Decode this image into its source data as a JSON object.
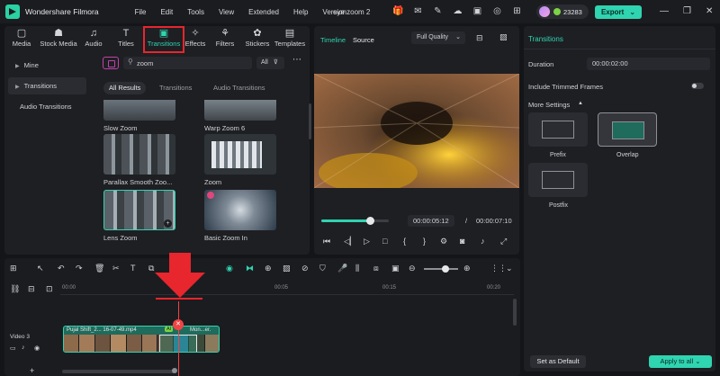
{
  "app": {
    "title": "Wondershare Filmora",
    "project_title": "eye zoom 2",
    "credits": "23283",
    "export_label": "Export"
  },
  "menu": [
    "File",
    "Edit",
    "Tools",
    "View",
    "Extended",
    "Help",
    "Version"
  ],
  "toolbar": [
    {
      "label": "Media",
      "icon": "media-icon"
    },
    {
      "label": "Stock Media",
      "icon": "stock-media-icon"
    },
    {
      "label": "Audio",
      "icon": "audio-icon"
    },
    {
      "label": "Titles",
      "icon": "titles-icon"
    },
    {
      "label": "Transitions",
      "icon": "transitions-icon",
      "active": true
    },
    {
      "label": "Effects",
      "icon": "effects-icon"
    },
    {
      "label": "Filters",
      "icon": "filters-icon"
    },
    {
      "label": "Stickers",
      "icon": "stickers-icon"
    },
    {
      "label": "Templates",
      "icon": "templates-icon"
    }
  ],
  "sidebar": {
    "items": [
      {
        "label": "Mine",
        "active": false
      },
      {
        "label": "Transitions",
        "active": true
      },
      {
        "label": "Audio Transitions",
        "active": false
      }
    ]
  },
  "search": {
    "value": "zoom",
    "filter_label": "All"
  },
  "subtabs": [
    {
      "label": "All Results",
      "active": true
    },
    {
      "label": "Transitions",
      "active": false
    },
    {
      "label": "Audio Transitions",
      "active": false
    }
  ],
  "library": {
    "items": [
      {
        "name": "Slow Zoom"
      },
      {
        "name": "Warp Zoom 6"
      },
      {
        "name": "Parallax Smooth Zoo..."
      },
      {
        "name": "Zoom"
      },
      {
        "name": "Lens Zoom"
      },
      {
        "name": "Basic Zoom In"
      }
    ]
  },
  "preview": {
    "tabs": [
      {
        "label": "Timeline",
        "active": true
      },
      {
        "label": "Source",
        "active": false
      }
    ],
    "quality": "Full Quality",
    "current_time": "00:00:05:12",
    "separator": "/",
    "total_time": "00:00:07:10",
    "progress_fraction": 0.72
  },
  "right_panel": {
    "title": "Transitions",
    "duration_label": "Duration",
    "duration_value": "00:00:02:00",
    "include_trimmed_label": "Include Trimmed Frames",
    "more_settings_label": "More Settings",
    "positions": [
      {
        "name": "Prefix",
        "selected": false
      },
      {
        "name": "Overlap",
        "selected": true
      },
      {
        "name": "Postfix",
        "selected": false
      }
    ],
    "set_default_label": "Set as Default",
    "apply_all_label": "Apply to all"
  },
  "timeline": {
    "ruler": [
      "00:00",
      "00:00:00:05",
      "00:00:00:10",
      "00:00:00:15",
      "00:00:00:20"
    ],
    "ruler_display": [
      "00:00",
      "00:05",
      "00:10",
      "00:15",
      "00:20"
    ],
    "track_label": "Video 3",
    "clip_title": "Pujal Shift_2... 16-07-49.mp4",
    "clip_ai_label": "AI",
    "clip_second": "Mon...er."
  },
  "colors": {
    "accent": "#2fd4b0",
    "highlight": "#e8262d"
  }
}
